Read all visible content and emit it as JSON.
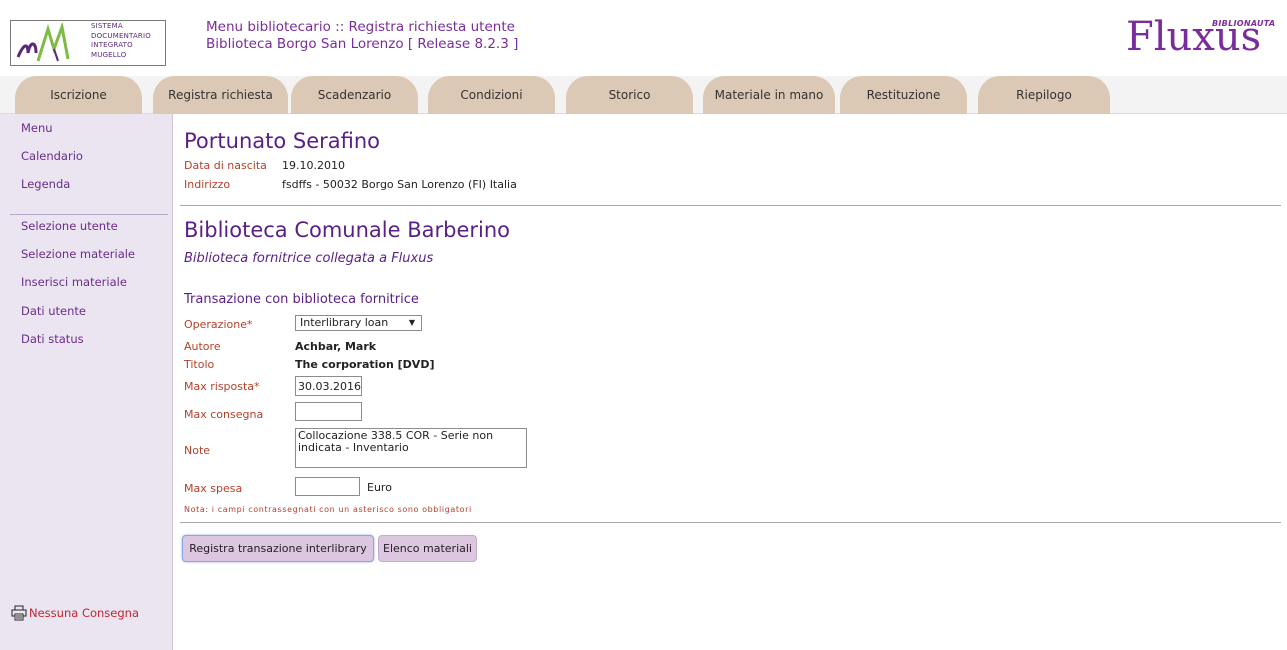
{
  "header": {
    "logo_lines": [
      "Sistema",
      "Documentario",
      "Integrato",
      "Mugello"
    ],
    "title_line1": "Menu bibliotecario :: Registra richiesta utente",
    "title_line2": "Biblioteca Borgo San Lorenzo [ Release 8.2.3 ]",
    "brand_small": "BIBLIONAUTA",
    "brand_big": "Fluxus"
  },
  "tabs": [
    {
      "label": "Iscrizione"
    },
    {
      "label": "Registra richiesta"
    },
    {
      "label": "Scadenzario"
    },
    {
      "label": "Condizioni"
    },
    {
      "label": "Storico"
    },
    {
      "label": "Materiale in mano"
    },
    {
      "label": "Restituzione"
    },
    {
      "label": "Riepilogo"
    }
  ],
  "sidebar": {
    "top_items": [
      {
        "label": "Menu"
      },
      {
        "label": "Calendario"
      },
      {
        "label": "Legenda"
      }
    ],
    "items": [
      {
        "label": "Selezione utente"
      },
      {
        "label": "Selezione materiale"
      },
      {
        "label": "Inserisci materiale"
      },
      {
        "label": "Dati utente"
      },
      {
        "label": "Dati status"
      }
    ],
    "footer": {
      "label": "Nessuna Consegna",
      "icon": "printer-icon"
    }
  },
  "user": {
    "name": "Portunato Serafino",
    "birth_label": "Data di nascita",
    "birth_value": "19.10.2010",
    "address_label": "Indirizzo",
    "address_value": "fsdffs - 50032 Borgo San Lorenzo (FI) Italia"
  },
  "library": {
    "name": "Biblioteca Comunale Barberino",
    "subtitle": "Biblioteca fornitrice collegata a Fluxus"
  },
  "form": {
    "section_title": "Transazione con biblioteca fornitrice",
    "operation_label": "Operazione*",
    "operation_value": "Interlibrary loan",
    "author_label": "Autore",
    "author_value": "Achbar, Mark",
    "title_label": "Titolo",
    "title_value": "The corporation [DVD]",
    "max_reply_label": "Max risposta*",
    "max_reply_value": "30.03.2016",
    "max_delivery_label": "Max consegna",
    "max_delivery_value": "",
    "note_label": "Note",
    "note_value": "Collocazione 338.5 COR - Serie non indicata - Inventario",
    "max_cost_label": "Max spesa",
    "max_cost_value": "",
    "currency": "Euro",
    "mandatory_note": "Nota: i campi contrassegnati con un asterisco sono obbligatori"
  },
  "buttons": {
    "register": "Registra transazione interlibrary",
    "materials": "Elenco materiali"
  },
  "colors": {
    "accent_purple": "#5a1f86",
    "label_red": "#b5402a",
    "tab_bg": "#dcc9b5",
    "sidebar_bg": "#ebe5f2",
    "button_bg": "#dcc6e0"
  }
}
